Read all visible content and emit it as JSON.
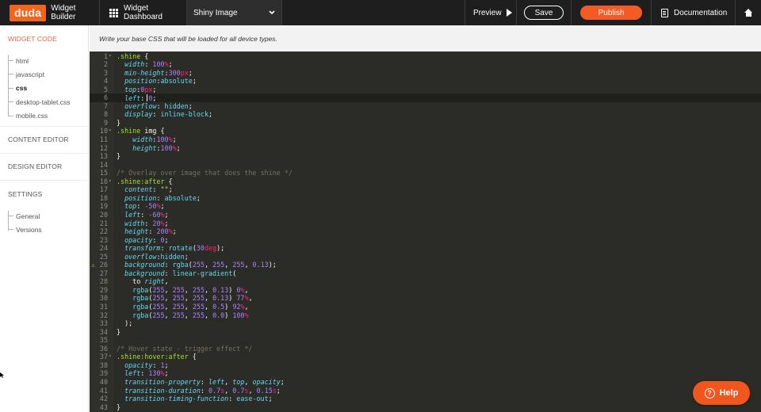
{
  "topbar": {
    "logo": "duda",
    "builder_title": "Widget Builder",
    "dashboard_label": "Widget Dashboard",
    "widget_name": "Shiny Image",
    "preview_label": "Preview",
    "save_label": "Save",
    "publish_label": "Publish",
    "docs_label": "Documentation",
    "accent": "#f45b24"
  },
  "sidebar": {
    "widget_code": "WIDGET CODE",
    "files": [
      "html",
      "javascript",
      "css",
      "desktop-tablet.css",
      "mobile.css"
    ],
    "active_file": "css",
    "content_editor": "CONTENT EDITOR",
    "design_editor": "DESIGN EDITOR",
    "settings": "SETTINGS",
    "settings_items": [
      "General",
      "Versions"
    ]
  },
  "editor": {
    "description": "Write your base CSS that will be loaded for all device types.",
    "warning_line": 26,
    "current_line": 6,
    "lines": [
      [
        [
          "sel",
          ".shine"
        ],
        [
          "punc",
          " {"
        ]
      ],
      [
        [
          "ind",
          "  "
        ],
        [
          "prop",
          "width"
        ],
        [
          "punc",
          ": "
        ],
        [
          "num",
          "100"
        ],
        [
          "unit",
          "%"
        ],
        [
          "punc",
          ";"
        ]
      ],
      [
        [
          "ind",
          "  "
        ],
        [
          "prop",
          "min-height"
        ],
        [
          "punc",
          ":"
        ],
        [
          "num",
          "300"
        ],
        [
          "unit",
          "px"
        ],
        [
          "punc",
          ";"
        ]
      ],
      [
        [
          "ind",
          "  "
        ],
        [
          "prop",
          "position"
        ],
        [
          "punc",
          ":"
        ],
        [
          "val",
          "absolute"
        ],
        [
          "punc",
          ";"
        ]
      ],
      [
        [
          "ind",
          "  "
        ],
        [
          "prop",
          "top"
        ],
        [
          "punc",
          ":"
        ],
        [
          "num",
          "0"
        ],
        [
          "unit",
          "px"
        ],
        [
          "punc",
          ";"
        ]
      ],
      [
        [
          "ind",
          "  "
        ],
        [
          "prop",
          "left"
        ],
        [
          "punc",
          ": "
        ],
        [
          "num",
          "0"
        ],
        [
          "punc",
          ";"
        ]
      ],
      [
        [
          "ind",
          "  "
        ],
        [
          "prop",
          "overflow"
        ],
        [
          "punc",
          ": "
        ],
        [
          "val",
          "hidden"
        ],
        [
          "punc",
          ";"
        ]
      ],
      [
        [
          "ind",
          "  "
        ],
        [
          "prop",
          "display"
        ],
        [
          "punc",
          ": "
        ],
        [
          "val",
          "inline-block"
        ],
        [
          "punc",
          ";"
        ]
      ],
      [
        [
          "punc",
          "}"
        ]
      ],
      [
        [
          "sel",
          ".shine"
        ],
        [
          "punc",
          " img {"
        ]
      ],
      [
        [
          "ind",
          "    "
        ],
        [
          "prop",
          "width"
        ],
        [
          "punc",
          ":"
        ],
        [
          "num",
          "100"
        ],
        [
          "unit",
          "%"
        ],
        [
          "punc",
          ";"
        ]
      ],
      [
        [
          "ind",
          "    "
        ],
        [
          "prop",
          "height"
        ],
        [
          "punc",
          ":"
        ],
        [
          "num",
          "100"
        ],
        [
          "unit",
          "%"
        ],
        [
          "punc",
          ";"
        ]
      ],
      [
        [
          "punc",
          "}"
        ]
      ],
      [],
      [
        [
          "com",
          "/* Overlay over image that does the shine */"
        ]
      ],
      [
        [
          "sel",
          ".shine:after"
        ],
        [
          "punc",
          " {"
        ]
      ],
      [
        [
          "ind",
          "  "
        ],
        [
          "prop",
          "content"
        ],
        [
          "punc",
          ": "
        ],
        [
          "str",
          "\"\""
        ],
        [
          "punc",
          ";"
        ]
      ],
      [
        [
          "ind",
          "  "
        ],
        [
          "prop",
          "position"
        ],
        [
          "punc",
          ": "
        ],
        [
          "val",
          "absolute"
        ],
        [
          "punc",
          ";"
        ]
      ],
      [
        [
          "ind",
          "  "
        ],
        [
          "prop",
          "top"
        ],
        [
          "punc",
          ": "
        ],
        [
          "num",
          "-50"
        ],
        [
          "unit",
          "%"
        ],
        [
          "punc",
          ";"
        ]
      ],
      [
        [
          "ind",
          "  "
        ],
        [
          "prop",
          "left"
        ],
        [
          "punc",
          ": "
        ],
        [
          "num",
          "-60"
        ],
        [
          "unit",
          "%"
        ],
        [
          "punc",
          ";"
        ]
      ],
      [
        [
          "ind",
          "  "
        ],
        [
          "prop",
          "width"
        ],
        [
          "punc",
          ": "
        ],
        [
          "num",
          "20"
        ],
        [
          "unit",
          "%"
        ],
        [
          "punc",
          ";"
        ]
      ],
      [
        [
          "ind",
          "  "
        ],
        [
          "prop",
          "height"
        ],
        [
          "punc",
          ": "
        ],
        [
          "num",
          "200"
        ],
        [
          "unit",
          "%"
        ],
        [
          "punc",
          ";"
        ]
      ],
      [
        [
          "ind",
          "  "
        ],
        [
          "prop",
          "opacity"
        ],
        [
          "punc",
          ": "
        ],
        [
          "num",
          "0"
        ],
        [
          "punc",
          ";"
        ]
      ],
      [
        [
          "ind",
          "  "
        ],
        [
          "prop",
          "transform"
        ],
        [
          "punc",
          ": "
        ],
        [
          "fn",
          "rotate"
        ],
        [
          "punc",
          "("
        ],
        [
          "num",
          "30"
        ],
        [
          "unit",
          "deg"
        ],
        [
          "punc",
          ");"
        ]
      ],
      [
        [
          "ind",
          "  "
        ],
        [
          "prop",
          "overflow"
        ],
        [
          "punc",
          ":"
        ],
        [
          "val",
          "hidden"
        ],
        [
          "punc",
          ";"
        ]
      ],
      [
        [
          "ind",
          "  "
        ],
        [
          "prop",
          "background"
        ],
        [
          "punc",
          ": "
        ],
        [
          "fn",
          "rgba"
        ],
        [
          "punc",
          "("
        ],
        [
          "num",
          "255"
        ],
        [
          "punc",
          ", "
        ],
        [
          "num",
          "255"
        ],
        [
          "punc",
          ", "
        ],
        [
          "num",
          "255"
        ],
        [
          "punc",
          ", "
        ],
        [
          "num",
          "0.13"
        ],
        [
          "punc",
          ");"
        ]
      ],
      [
        [
          "ind",
          "  "
        ],
        [
          "prop",
          "background"
        ],
        [
          "punc",
          ": "
        ],
        [
          "fn",
          "linear-gradient"
        ],
        [
          "punc",
          "("
        ]
      ],
      [
        [
          "ind",
          "    "
        ],
        [
          "punc",
          "to "
        ],
        [
          "var",
          "right"
        ],
        [
          "punc",
          ","
        ]
      ],
      [
        [
          "ind",
          "    "
        ],
        [
          "fn",
          "rgba"
        ],
        [
          "punc",
          "("
        ],
        [
          "num",
          "255"
        ],
        [
          "punc",
          ", "
        ],
        [
          "num",
          "255"
        ],
        [
          "punc",
          ", "
        ],
        [
          "num",
          "255"
        ],
        [
          "punc",
          ", "
        ],
        [
          "num",
          "0.13"
        ],
        [
          "punc",
          ") "
        ],
        [
          "num",
          "0"
        ],
        [
          "unit",
          "%"
        ],
        [
          "punc",
          ","
        ]
      ],
      [
        [
          "ind",
          "    "
        ],
        [
          "fn",
          "rgba"
        ],
        [
          "punc",
          "("
        ],
        [
          "num",
          "255"
        ],
        [
          "punc",
          ", "
        ],
        [
          "num",
          "255"
        ],
        [
          "punc",
          ", "
        ],
        [
          "num",
          "255"
        ],
        [
          "punc",
          ", "
        ],
        [
          "num",
          "0.13"
        ],
        [
          "punc",
          ") "
        ],
        [
          "num",
          "77"
        ],
        [
          "unit",
          "%"
        ],
        [
          "punc",
          ","
        ]
      ],
      [
        [
          "ind",
          "    "
        ],
        [
          "fn",
          "rgba"
        ],
        [
          "punc",
          "("
        ],
        [
          "num",
          "255"
        ],
        [
          "punc",
          ", "
        ],
        [
          "num",
          "255"
        ],
        [
          "punc",
          ", "
        ],
        [
          "num",
          "255"
        ],
        [
          "punc",
          ", "
        ],
        [
          "num",
          "0.5"
        ],
        [
          "punc",
          ") "
        ],
        [
          "num",
          "92"
        ],
        [
          "unit",
          "%"
        ],
        [
          "punc",
          ","
        ]
      ],
      [
        [
          "ind",
          "    "
        ],
        [
          "fn",
          "rgba"
        ],
        [
          "punc",
          "("
        ],
        [
          "num",
          "255"
        ],
        [
          "punc",
          ", "
        ],
        [
          "num",
          "255"
        ],
        [
          "punc",
          ", "
        ],
        [
          "num",
          "255"
        ],
        [
          "punc",
          ", "
        ],
        [
          "num",
          "0.0"
        ],
        [
          "punc",
          ") "
        ],
        [
          "num",
          "100"
        ],
        [
          "unit",
          "%"
        ]
      ],
      [
        [
          "ind",
          "  "
        ],
        [
          "punc",
          ");"
        ]
      ],
      [
        [
          "punc",
          "}"
        ]
      ],
      [],
      [
        [
          "com",
          "/* Hover state - trigger effect */"
        ]
      ],
      [
        [
          "sel",
          ".shine:hover:after"
        ],
        [
          "punc",
          " {"
        ]
      ],
      [
        [
          "ind",
          "  "
        ],
        [
          "prop",
          "opacity"
        ],
        [
          "punc",
          ": "
        ],
        [
          "num",
          "1"
        ],
        [
          "punc",
          ";"
        ]
      ],
      [
        [
          "ind",
          "  "
        ],
        [
          "prop",
          "left"
        ],
        [
          "punc",
          ": "
        ],
        [
          "num",
          "130"
        ],
        [
          "unit",
          "%"
        ],
        [
          "punc",
          ";"
        ]
      ],
      [
        [
          "ind",
          "  "
        ],
        [
          "prop",
          "transition-property"
        ],
        [
          "punc",
          ": "
        ],
        [
          "var",
          "left"
        ],
        [
          "punc",
          ", "
        ],
        [
          "var",
          "top"
        ],
        [
          "punc",
          ", "
        ],
        [
          "var",
          "opacity"
        ],
        [
          "punc",
          ";"
        ]
      ],
      [
        [
          "ind",
          "  "
        ],
        [
          "prop",
          "transition-duration"
        ],
        [
          "punc",
          ": "
        ],
        [
          "num",
          "0.7"
        ],
        [
          "unit",
          "s"
        ],
        [
          "punc",
          ", "
        ],
        [
          "num",
          "0.7"
        ],
        [
          "unit",
          "s"
        ],
        [
          "punc",
          ", "
        ],
        [
          "num",
          "0.15"
        ],
        [
          "unit",
          "s"
        ],
        [
          "punc",
          ";"
        ]
      ],
      [
        [
          "ind",
          "  "
        ],
        [
          "prop",
          "transition-timing-function"
        ],
        [
          "punc",
          ": "
        ],
        [
          "val",
          "ease-out"
        ],
        [
          "punc",
          ";"
        ]
      ],
      [
        [
          "punc",
          "}"
        ]
      ]
    ],
    "fold_lines": [
      1,
      10,
      16,
      37
    ]
  },
  "help": {
    "label": "Help"
  }
}
